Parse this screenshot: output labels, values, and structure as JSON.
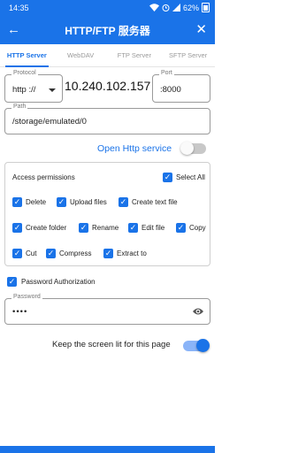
{
  "status": {
    "time": "14:35",
    "battery": "62%"
  },
  "header": {
    "title": "HTTP/FTP 服务器"
  },
  "tabs": [
    {
      "label": "HTTP Server",
      "active": true
    },
    {
      "label": "WebDAV",
      "active": false
    },
    {
      "label": "FTP Server",
      "active": false
    },
    {
      "label": "SFTP Server",
      "active": false
    }
  ],
  "server": {
    "protocol_label": "Protocol",
    "protocol_value": "http ://",
    "ip": "10.240.102.157",
    "port_label": "Port",
    "port_value": ":8000",
    "path_label": "Path",
    "path_value": "/storage/emulated/0",
    "open_http_label": "Open Http service",
    "open_http_on": false
  },
  "permissions": {
    "title": "Access permissions",
    "select_all": {
      "label": "Select All",
      "checked": true
    },
    "items": [
      {
        "label": "Delete",
        "checked": true
      },
      {
        "label": "Upload files",
        "checked": true
      },
      {
        "label": "Create text file",
        "checked": true
      },
      {
        "label": "Create folder",
        "checked": true
      },
      {
        "label": "Rename",
        "checked": true
      },
      {
        "label": "Edit file",
        "checked": true
      },
      {
        "label": "Copy",
        "checked": true
      },
      {
        "label": "Cut",
        "checked": true
      },
      {
        "label": "Compress",
        "checked": true
      },
      {
        "label": "Extract to",
        "checked": true
      }
    ]
  },
  "auth": {
    "label": "Password Authorization",
    "checked": true,
    "password_label": "Password",
    "password_value": "••••"
  },
  "keep_screen": {
    "label": "Keep the screen lit for this page",
    "on": true
  },
  "colors": {
    "accent": "#1a73e8"
  }
}
